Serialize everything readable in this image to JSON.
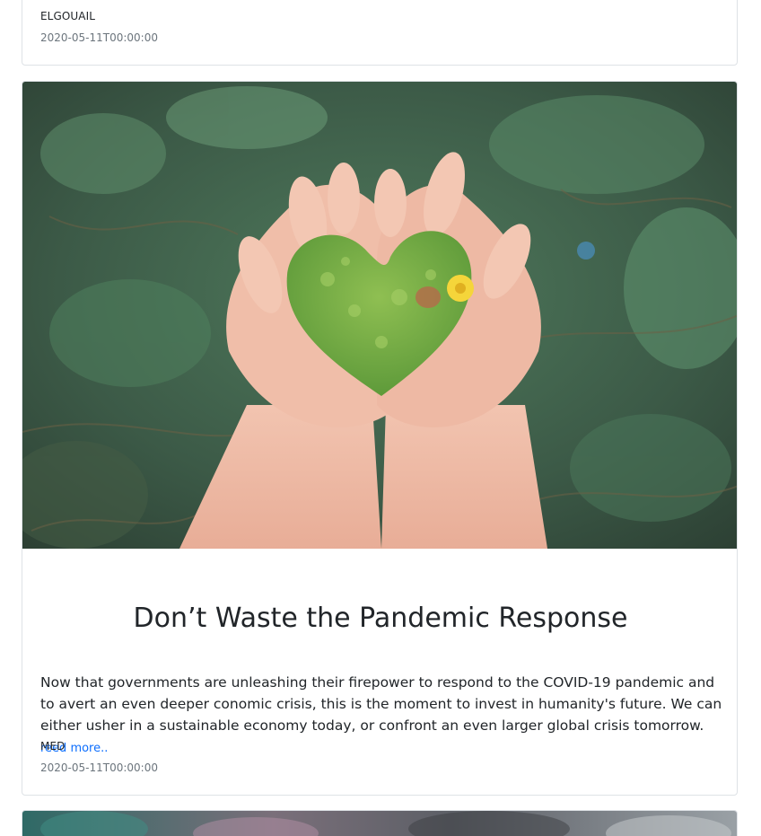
{
  "previous_post": {
    "author": "ELGOUAIL",
    "date": "2020-05-11T00:00:00"
  },
  "post": {
    "image_alt": "Hands holding a heart-shaped patch of moss with a small yellow flower",
    "title": "Don’t Waste the Pandemic Response",
    "excerpt": "Now that governments are unleashing their firepower to respond to the COVID-19 pandemic and to avert an even deeper conomic crisis, this is the moment to invest in humanity's future. We can either usher in a sustainable economy today, or confront an even larger global crisis tomorrow.",
    "read_more": "reed more..",
    "author": "MED",
    "date": "2020-05-11T00:00:00"
  },
  "colors": {
    "link": "#0d6efd",
    "muted": "#6c757d",
    "border": "#dee2e6"
  }
}
